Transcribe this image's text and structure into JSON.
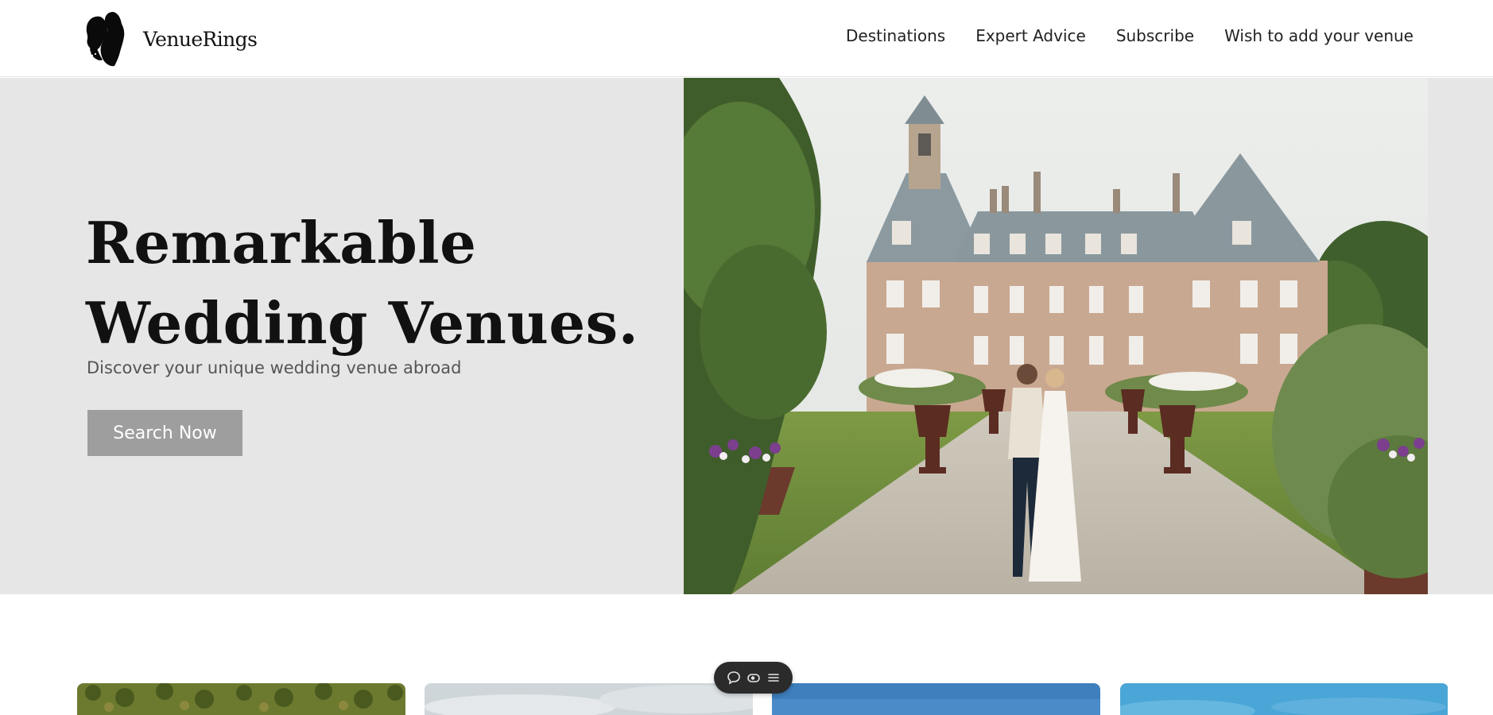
{
  "header": {
    "logo_text": "VenueRings",
    "nav": [
      {
        "label": "Destinations"
      },
      {
        "label": "Expert Advice"
      },
      {
        "label": "Subscribe"
      },
      {
        "label": "Wish to add your venue"
      }
    ]
  },
  "hero": {
    "title_line1": "Remarkable",
    "title_line2": "Wedding Venues.",
    "subtitle": "Discover your unique wedding venue abroad",
    "cta_label": "Search Now",
    "cta_color": "#9e9e9e",
    "background": "#e6e6e6",
    "photo": "chateau-wedding-couple-photo"
  },
  "cards": [
    {
      "image": "olive-grove-photo"
    },
    {
      "image": "cloudy-sky-photo"
    },
    {
      "image": "blue-sky-photo"
    },
    {
      "image": "bright-sky-photo"
    }
  ],
  "float_toolbar": {
    "icons": [
      "chat-bubble-icon",
      "eye-toggle-icon",
      "menu-icon"
    ]
  }
}
